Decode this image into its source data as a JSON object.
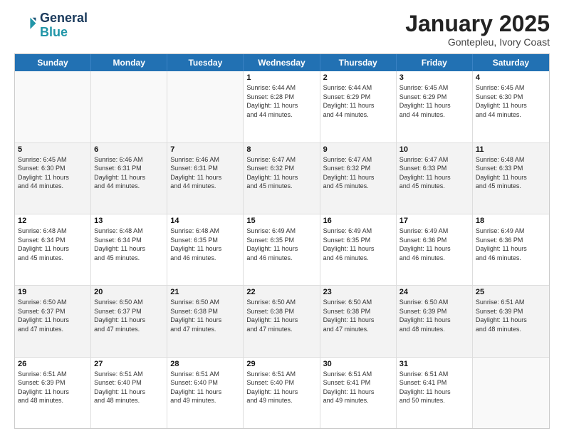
{
  "logo": {
    "line1": "General",
    "line2": "Blue"
  },
  "title": "January 2025",
  "subtitle": "Gontepleu, Ivory Coast",
  "days_of_week": [
    "Sunday",
    "Monday",
    "Tuesday",
    "Wednesday",
    "Thursday",
    "Friday",
    "Saturday"
  ],
  "weeks": [
    [
      {
        "day": "",
        "info": ""
      },
      {
        "day": "",
        "info": ""
      },
      {
        "day": "",
        "info": ""
      },
      {
        "day": "1",
        "info": "Sunrise: 6:44 AM\nSunset: 6:28 PM\nDaylight: 11 hours\nand 44 minutes."
      },
      {
        "day": "2",
        "info": "Sunrise: 6:44 AM\nSunset: 6:29 PM\nDaylight: 11 hours\nand 44 minutes."
      },
      {
        "day": "3",
        "info": "Sunrise: 6:45 AM\nSunset: 6:29 PM\nDaylight: 11 hours\nand 44 minutes."
      },
      {
        "day": "4",
        "info": "Sunrise: 6:45 AM\nSunset: 6:30 PM\nDaylight: 11 hours\nand 44 minutes."
      }
    ],
    [
      {
        "day": "5",
        "info": "Sunrise: 6:45 AM\nSunset: 6:30 PM\nDaylight: 11 hours\nand 44 minutes."
      },
      {
        "day": "6",
        "info": "Sunrise: 6:46 AM\nSunset: 6:31 PM\nDaylight: 11 hours\nand 44 minutes."
      },
      {
        "day": "7",
        "info": "Sunrise: 6:46 AM\nSunset: 6:31 PM\nDaylight: 11 hours\nand 44 minutes."
      },
      {
        "day": "8",
        "info": "Sunrise: 6:47 AM\nSunset: 6:32 PM\nDaylight: 11 hours\nand 45 minutes."
      },
      {
        "day": "9",
        "info": "Sunrise: 6:47 AM\nSunset: 6:32 PM\nDaylight: 11 hours\nand 45 minutes."
      },
      {
        "day": "10",
        "info": "Sunrise: 6:47 AM\nSunset: 6:33 PM\nDaylight: 11 hours\nand 45 minutes."
      },
      {
        "day": "11",
        "info": "Sunrise: 6:48 AM\nSunset: 6:33 PM\nDaylight: 11 hours\nand 45 minutes."
      }
    ],
    [
      {
        "day": "12",
        "info": "Sunrise: 6:48 AM\nSunset: 6:34 PM\nDaylight: 11 hours\nand 45 minutes."
      },
      {
        "day": "13",
        "info": "Sunrise: 6:48 AM\nSunset: 6:34 PM\nDaylight: 11 hours\nand 45 minutes."
      },
      {
        "day": "14",
        "info": "Sunrise: 6:48 AM\nSunset: 6:35 PM\nDaylight: 11 hours\nand 46 minutes."
      },
      {
        "day": "15",
        "info": "Sunrise: 6:49 AM\nSunset: 6:35 PM\nDaylight: 11 hours\nand 46 minutes."
      },
      {
        "day": "16",
        "info": "Sunrise: 6:49 AM\nSunset: 6:35 PM\nDaylight: 11 hours\nand 46 minutes."
      },
      {
        "day": "17",
        "info": "Sunrise: 6:49 AM\nSunset: 6:36 PM\nDaylight: 11 hours\nand 46 minutes."
      },
      {
        "day": "18",
        "info": "Sunrise: 6:49 AM\nSunset: 6:36 PM\nDaylight: 11 hours\nand 46 minutes."
      }
    ],
    [
      {
        "day": "19",
        "info": "Sunrise: 6:50 AM\nSunset: 6:37 PM\nDaylight: 11 hours\nand 47 minutes."
      },
      {
        "day": "20",
        "info": "Sunrise: 6:50 AM\nSunset: 6:37 PM\nDaylight: 11 hours\nand 47 minutes."
      },
      {
        "day": "21",
        "info": "Sunrise: 6:50 AM\nSunset: 6:38 PM\nDaylight: 11 hours\nand 47 minutes."
      },
      {
        "day": "22",
        "info": "Sunrise: 6:50 AM\nSunset: 6:38 PM\nDaylight: 11 hours\nand 47 minutes."
      },
      {
        "day": "23",
        "info": "Sunrise: 6:50 AM\nSunset: 6:38 PM\nDaylight: 11 hours\nand 47 minutes."
      },
      {
        "day": "24",
        "info": "Sunrise: 6:50 AM\nSunset: 6:39 PM\nDaylight: 11 hours\nand 48 minutes."
      },
      {
        "day": "25",
        "info": "Sunrise: 6:51 AM\nSunset: 6:39 PM\nDaylight: 11 hours\nand 48 minutes."
      }
    ],
    [
      {
        "day": "26",
        "info": "Sunrise: 6:51 AM\nSunset: 6:39 PM\nDaylight: 11 hours\nand 48 minutes."
      },
      {
        "day": "27",
        "info": "Sunrise: 6:51 AM\nSunset: 6:40 PM\nDaylight: 11 hours\nand 48 minutes."
      },
      {
        "day": "28",
        "info": "Sunrise: 6:51 AM\nSunset: 6:40 PM\nDaylight: 11 hours\nand 49 minutes."
      },
      {
        "day": "29",
        "info": "Sunrise: 6:51 AM\nSunset: 6:40 PM\nDaylight: 11 hours\nand 49 minutes."
      },
      {
        "day": "30",
        "info": "Sunrise: 6:51 AM\nSunset: 6:41 PM\nDaylight: 11 hours\nand 49 minutes."
      },
      {
        "day": "31",
        "info": "Sunrise: 6:51 AM\nSunset: 6:41 PM\nDaylight: 11 hours\nand 50 minutes."
      },
      {
        "day": "",
        "info": ""
      }
    ]
  ],
  "colors": {
    "header_bg": "#2271b3",
    "alt_row": "#f3f3f3",
    "empty_bg": "#f9f9f9"
  }
}
